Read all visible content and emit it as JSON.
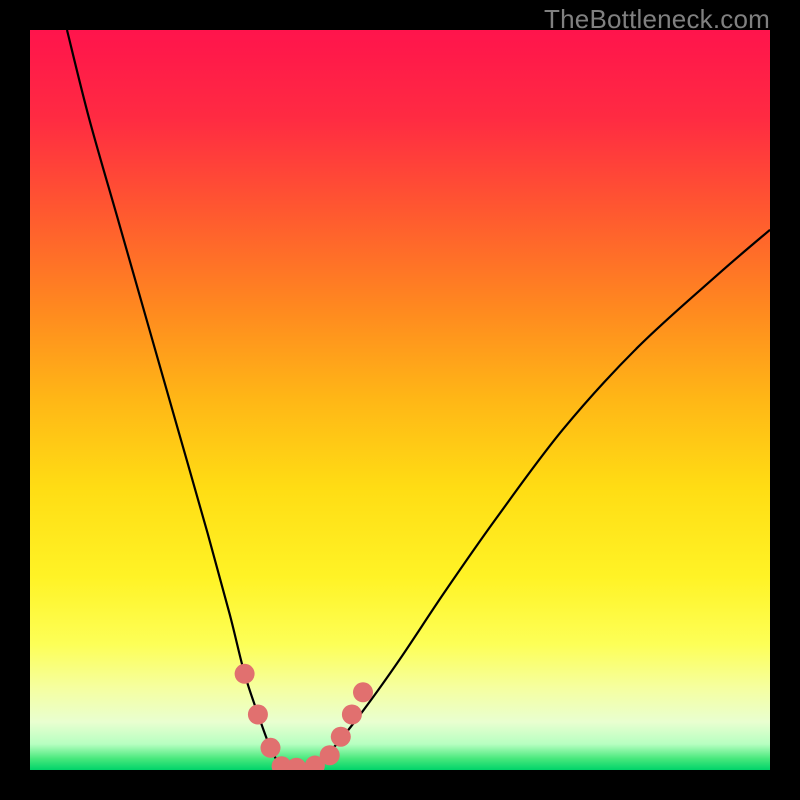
{
  "watermark": "TheBottleneck.com",
  "chart_data": {
    "type": "line",
    "title": "",
    "xlabel": "",
    "ylabel": "",
    "xlim": [
      0,
      100
    ],
    "ylim": [
      0,
      100
    ],
    "series": [
      {
        "name": "bottleneck-curve",
        "x": [
          5,
          8,
          12,
          16,
          20,
          24,
          27,
          29,
          31,
          32.5,
          34,
          36,
          38.5,
          41,
          45,
          50,
          56,
          63,
          72,
          82,
          93,
          100
        ],
        "y": [
          100,
          88,
          74,
          60,
          46,
          32,
          21,
          13,
          7,
          3,
          0.5,
          0,
          1,
          3,
          8,
          15,
          24,
          34,
          46,
          57,
          67,
          73
        ]
      }
    ],
    "markers": {
      "name": "bottleneck-markers",
      "color": "#e1706f",
      "points": [
        {
          "x": 29.0,
          "y": 13.0
        },
        {
          "x": 30.8,
          "y": 7.5
        },
        {
          "x": 32.5,
          "y": 3.0
        },
        {
          "x": 34.0,
          "y": 0.5
        },
        {
          "x": 36.0,
          "y": 0.3
        },
        {
          "x": 38.5,
          "y": 0.6
        },
        {
          "x": 40.5,
          "y": 2.0
        },
        {
          "x": 42.0,
          "y": 4.5
        },
        {
          "x": 43.5,
          "y": 7.5
        },
        {
          "x": 45.0,
          "y": 10.5
        }
      ]
    },
    "background": {
      "gradient_stops": [
        {
          "pos": 0.0,
          "color": "#ff144c"
        },
        {
          "pos": 0.12,
          "color": "#ff2b42"
        },
        {
          "pos": 0.25,
          "color": "#ff5a2f"
        },
        {
          "pos": 0.38,
          "color": "#ff8a1f"
        },
        {
          "pos": 0.5,
          "color": "#ffb716"
        },
        {
          "pos": 0.62,
          "color": "#ffdd14"
        },
        {
          "pos": 0.74,
          "color": "#fff326"
        },
        {
          "pos": 0.83,
          "color": "#fdff57"
        },
        {
          "pos": 0.89,
          "color": "#f5ffa1"
        },
        {
          "pos": 0.935,
          "color": "#e9ffd0"
        },
        {
          "pos": 0.965,
          "color": "#b7ffc1"
        },
        {
          "pos": 0.985,
          "color": "#46e87c"
        },
        {
          "pos": 1.0,
          "color": "#00d36a"
        }
      ]
    }
  }
}
